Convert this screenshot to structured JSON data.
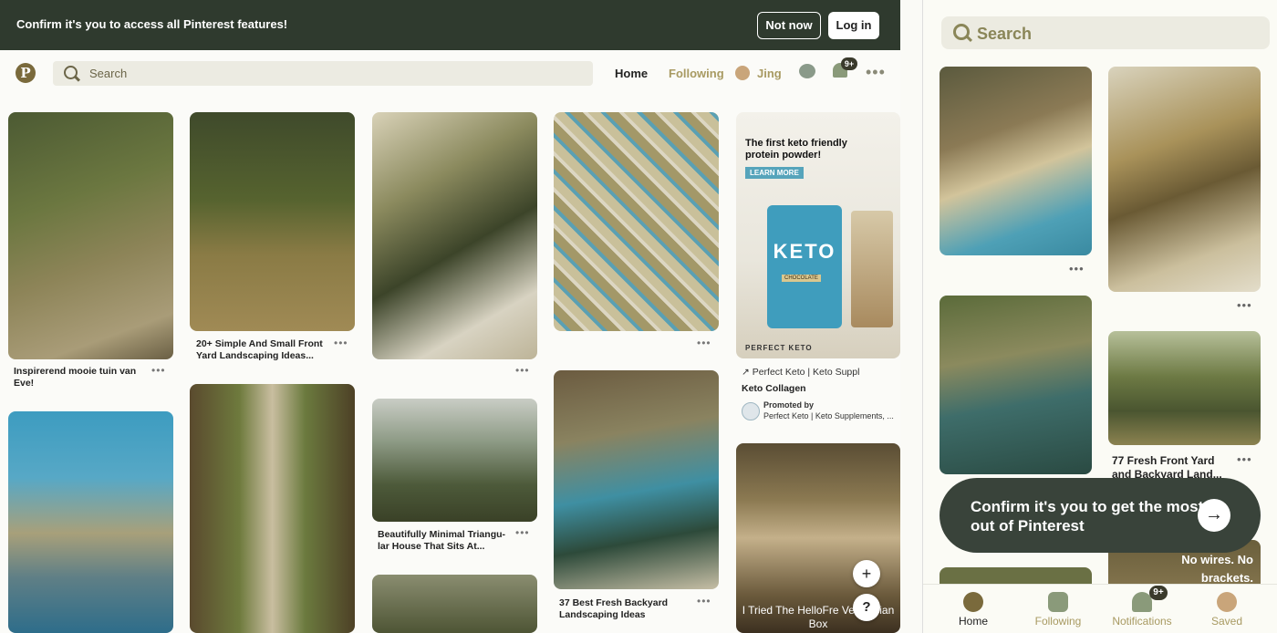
{
  "banner": {
    "text": "Confirm it's you to access all Pinterest features!",
    "not_now": "Not now",
    "log_in": "Log in"
  },
  "nav": {
    "logo": "P",
    "search_placeholder": "Search",
    "home": "Home",
    "following": "Following",
    "user": "Jing",
    "notif_badge": "9+",
    "more": "•••"
  },
  "pins": {
    "p1_caption": "Inspirerend mooie tuin van Eve!",
    "p2_caption": "20+ Simple And Small Front Yard Landscaping Ideas...",
    "p3_caption": "Beautifully Minimal Triangu-lar House That Sits At...",
    "p4_caption": "37 Best Fresh Backyard Landscaping Ideas",
    "ad_headline": "The first keto friendly protein powder!",
    "ad_cta": "LEARN MORE",
    "ad_brand_tag": "PERFECT KETO",
    "ad_jar_text": "KETO",
    "ad_jar_sub": "CHOCOLATE",
    "ad_link": "↗ Perfect Keto | Keto Suppl",
    "ad_title": "Keto Collagen",
    "ad_promoted": "Promoted by",
    "ad_promoter": "Perfect Keto | Keto Supplements, ...",
    "hellofresh_text": "I Tried The HelloFre Vegetarian Box",
    "dots": "•••"
  },
  "float": {
    "plus": "+",
    "help": "?"
  },
  "mobile": {
    "search_placeholder": "Search",
    "caption1": "77 Fresh Front Yard and Backyard Land...",
    "overlay_text": "No wires. No brackets.",
    "toast_text": "Confirm it's you to get the most out of Pinterest",
    "toast_arrow": "→",
    "tabs": [
      {
        "label": "Home"
      },
      {
        "label": "Following"
      },
      {
        "label": "Notifications"
      },
      {
        "label": "Saved"
      }
    ],
    "notif_badge": "9+"
  },
  "colors": {
    "banner": "#2f3a2e",
    "accent": "#a89a62",
    "toast": "#39433a"
  }
}
